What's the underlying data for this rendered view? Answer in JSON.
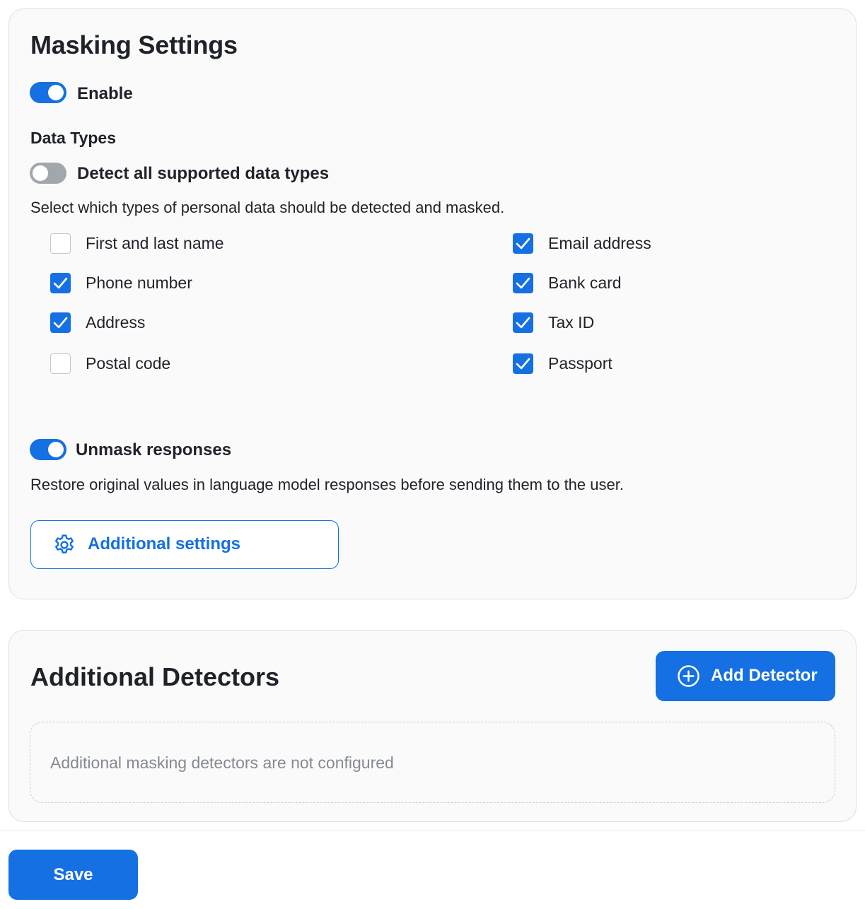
{
  "masking": {
    "title": "Masking Settings",
    "enable": {
      "label": "Enable",
      "on": true
    },
    "data_types_label": "Data Types",
    "detect_all": {
      "label": "Detect all supported data types",
      "on": false
    },
    "description": "Select which types of personal data should be detected and masked.",
    "data_types": [
      {
        "label": "First and last name",
        "checked": false
      },
      {
        "label": "Phone number",
        "checked": true
      },
      {
        "label": "Address",
        "checked": true
      },
      {
        "label": "Postal code",
        "checked": false
      },
      {
        "label": "Email address",
        "checked": true
      },
      {
        "label": "Bank card",
        "checked": true
      },
      {
        "label": "Tax ID",
        "checked": true
      },
      {
        "label": "Passport",
        "checked": true
      }
    ],
    "unmask": {
      "label": "Unmask responses",
      "on": true
    },
    "unmask_description": "Restore original values in language model responses before sending them to the user.",
    "additional_settings_label": "Additional settings",
    "additional_settings_icon": "gear-icon"
  },
  "detectors": {
    "title": "Additional Detectors",
    "add_button_label": "Add Detector",
    "add_button_icon": "plus-circle-icon",
    "empty_text": "Additional masking detectors are not configured"
  },
  "footer": {
    "save_label": "Save"
  },
  "colors": {
    "accent": "#1570e3",
    "toggle_off": "#a2a7ae",
    "text": "#1f2329",
    "muted_text": "#858a92"
  }
}
